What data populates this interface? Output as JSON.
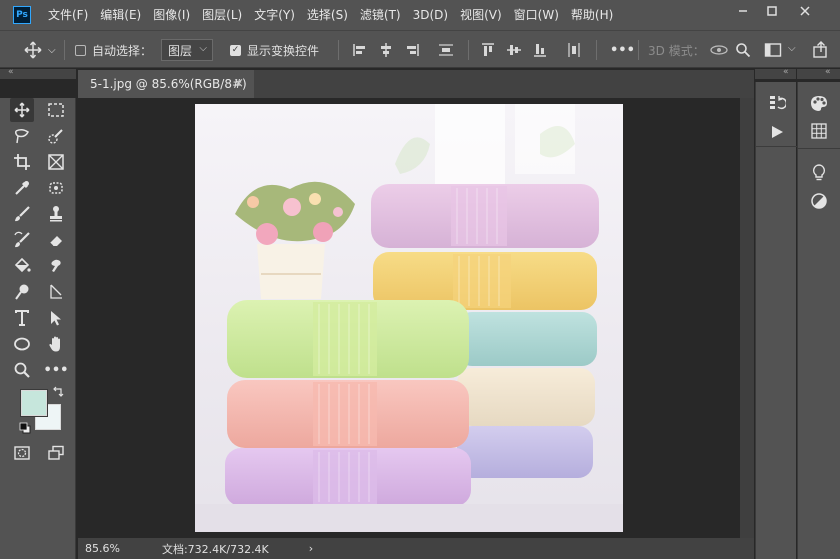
{
  "app": {
    "logo_text": "Ps",
    "brand_color": "#31a8ff"
  },
  "menu": [
    "文件(F)",
    "编辑(E)",
    "图像(I)",
    "图层(L)",
    "文字(Y)",
    "选择(S)",
    "滤镜(T)",
    "3D(D)",
    "视图(V)",
    "窗口(W)",
    "帮助(H)"
  ],
  "window_controls": {
    "minimize": "minimize-icon",
    "maximize": "maximize-icon",
    "close": "close-icon"
  },
  "options": {
    "auto_select_label": "自动选择：",
    "auto_select_checked": false,
    "auto_select_target": "图层",
    "show_transform_label": "显示变换控件",
    "show_transform_checked": true,
    "more_label": "•••",
    "mode_3d_label": "3D 模式："
  },
  "document": {
    "tab_title": "5-1.jpg @ 85.6%(RGB/8#)",
    "close_symbol": "×"
  },
  "status": {
    "zoom": "85.6%",
    "doc_info": "文档:732.4K/732.4K",
    "arrow": "›"
  },
  "colors": {
    "foreground": "#c6e6dc",
    "background": "#eef5f6",
    "ui_panel": "#535353",
    "ui_dark": "#282828"
  },
  "tools": [
    "move-tool-icon",
    "marquee-tool-icon",
    "lasso-tool-icon",
    "quick-select-tool-icon",
    "crop-tool-icon",
    "frame-tool-icon",
    "eyedropper-tool-icon",
    "spot-heal-tool-icon",
    "brush-tool-icon",
    "stamp-tool-icon",
    "history-brush-tool-icon",
    "eraser-tool-icon",
    "bucket-tool-icon",
    "smudge-tool-icon",
    "dodge-tool-icon",
    "pen-tool-icon",
    "type-tool-icon",
    "path-select-tool-icon",
    "ellipse-tool-icon",
    "hand-tool-icon",
    "zoom-tool-icon",
    "more-tools-icon",
    "quick-mask-icon",
    "screen-mode-icon"
  ],
  "right_panels": {
    "col1": [
      "history-icon",
      "actions-play-icon"
    ],
    "col2": [
      "color-palette-icon",
      "swatches-grid-icon",
      "learn-bulb-icon",
      "adjustments-icon"
    ]
  }
}
